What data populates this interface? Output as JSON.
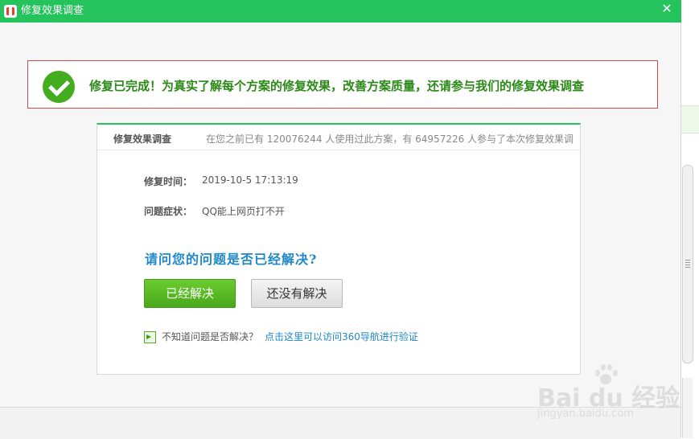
{
  "window": {
    "title": "修复效果调查",
    "close_glyph": "✕"
  },
  "banner": {
    "message": "修复已完成！为真实了解每个方案的修复效果，改善方案质量，还请参与我们的修复效果调查"
  },
  "card": {
    "title": "修复效果调查",
    "stats": "在您之前已有 120076244 人使用过此方案，有 64957226 人参与了本次修复效果调",
    "rows": [
      {
        "label": "修复时间：",
        "value": "2019-10-5 17:13:19"
      },
      {
        "label": "问题症状：",
        "value": "QQ能上网页打不开"
      }
    ],
    "question": "请问您的问题是否已经解决?",
    "yes_label": "已经解决",
    "no_label": "还没有解决",
    "hint_text": "不知道问题是否解决？",
    "hint_link": "点击这里可以访问360导航进行验证"
  },
  "watermark": {
    "brand": "Bai du 经验",
    "url": "jingyan.baidu.com"
  },
  "colors": {
    "titlebar": "#25c35c",
    "banner_border": "#d94a4a",
    "success_green": "#44ad1f",
    "link_blue": "#1e88c8"
  }
}
